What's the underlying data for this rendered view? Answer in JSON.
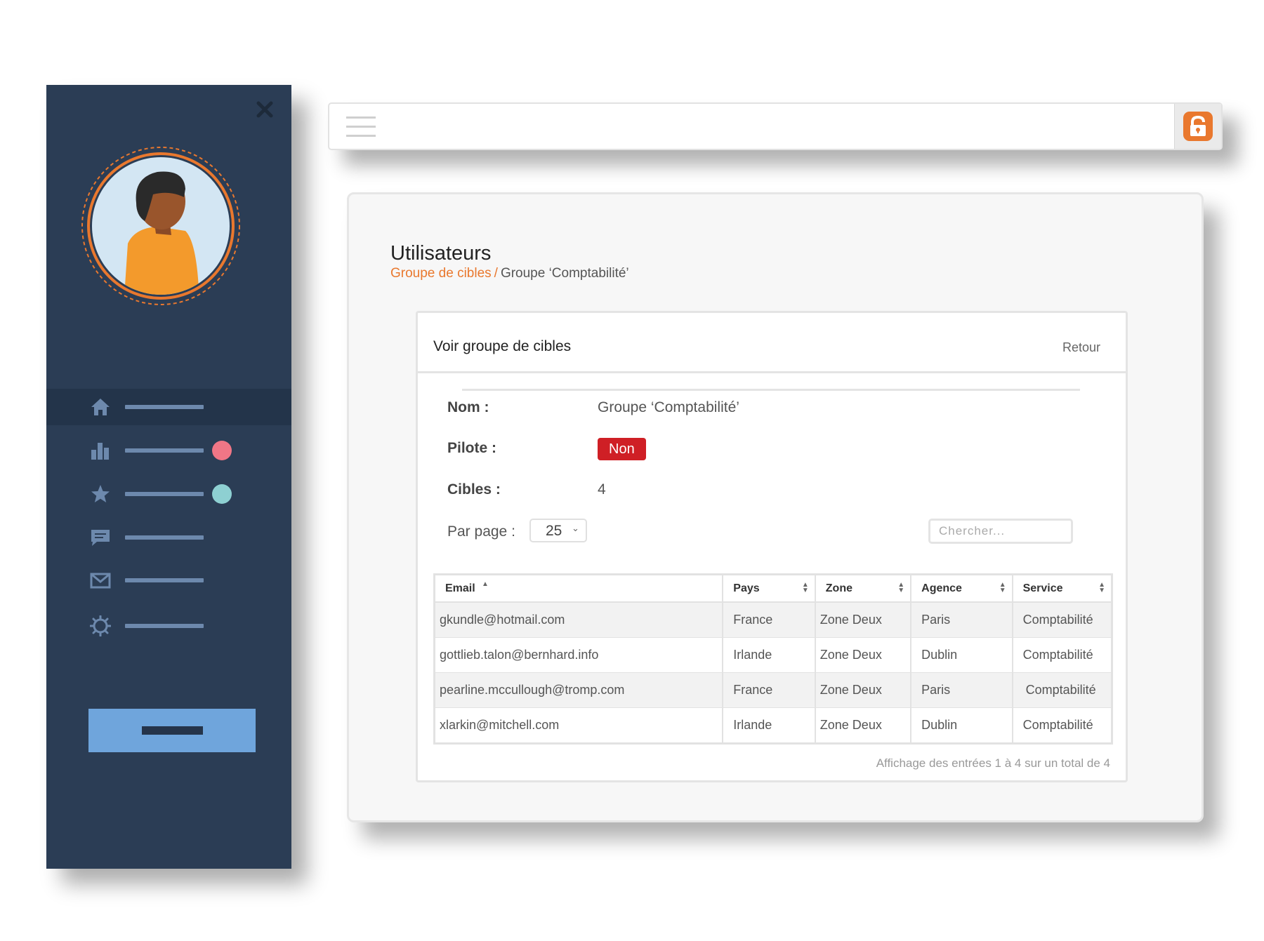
{
  "colors": {
    "sidebar_bg": "#2b3d55",
    "accent": "#e9782e",
    "badge_red": "#cf1f25",
    "dot_pink": "#f07686",
    "dot_teal": "#8ed0d2",
    "sidebar_button": "#6fa5dc"
  },
  "sidebar": {
    "items": [
      {
        "icon": "home-icon",
        "active": true
      },
      {
        "icon": "bar-chart-icon",
        "badge": "pink-dot"
      },
      {
        "icon": "star-icon",
        "badge": "teal-dot"
      },
      {
        "icon": "chat-icon"
      },
      {
        "icon": "mail-icon"
      },
      {
        "icon": "gear-icon"
      }
    ]
  },
  "page": {
    "title": "Utilisateurs",
    "breadcrumb": {
      "link": "Groupe de cibles",
      "separator": "/",
      "current": "Groupe ‘Comptabilité’"
    }
  },
  "panel": {
    "title": "Voir groupe de cibles",
    "back_label": "Retour",
    "fields": {
      "nom_label": "Nom :",
      "nom_value": "Groupe ‘Comptabilité’",
      "pilote_label": "Pilote :",
      "pilote_value": "Non",
      "cibles_label": "Cibles :",
      "cibles_value": "4"
    },
    "per_page_label": "Par page :",
    "per_page_value": "25",
    "search_placeholder": "Chercher..."
  },
  "table": {
    "columns": [
      "Email",
      "Pays",
      "Zone",
      "Agence",
      "Service"
    ],
    "rows": [
      {
        "email": "gkundle@hotmail.com",
        "pays": "France",
        "zone": "Zone Deux",
        "agence": "Paris",
        "service": "Comptabilité"
      },
      {
        "email": "gottlieb.talon@bernhard.info",
        "pays": "Irlande",
        "zone": "Zone Deux",
        "agence": "Dublin",
        "service": "Comptabilité"
      },
      {
        "email": "pearline.mccullough@tromp.com",
        "pays": "France",
        "zone": "Zone Deux",
        "agence": "Paris",
        "service": "Comptabilité"
      },
      {
        "email": "xlarkin@mitchell.com",
        "pays": "Irlande",
        "zone": "Zone Deux",
        "agence": "Dublin",
        "service": "Comptabilité"
      }
    ],
    "footer": "Affichage des entrées 1 à 4 sur un total de 4"
  }
}
